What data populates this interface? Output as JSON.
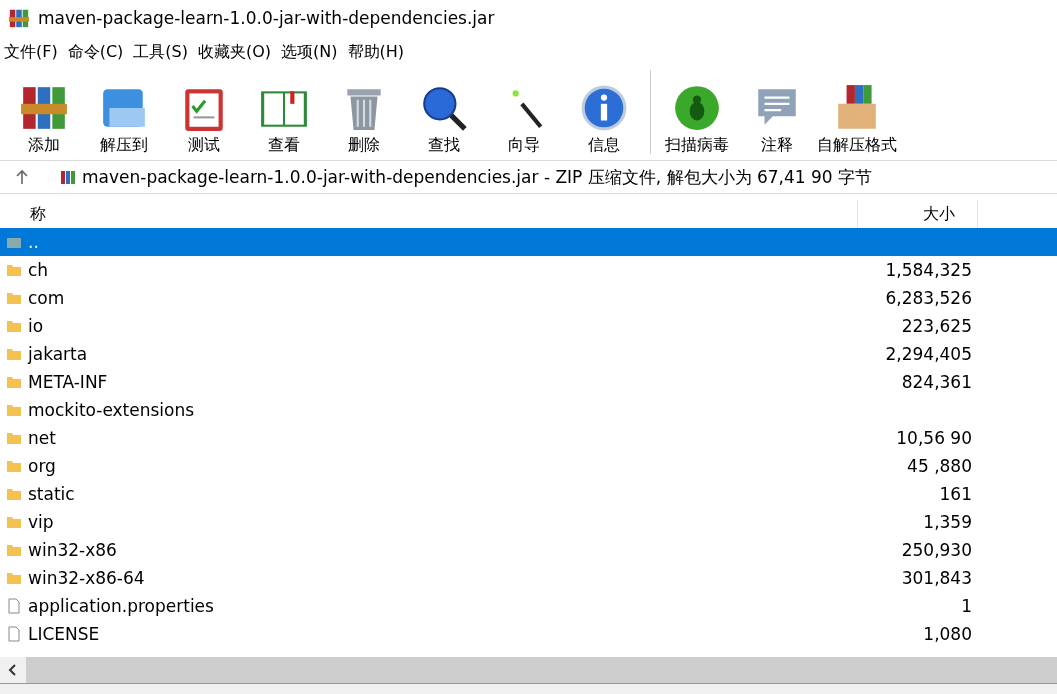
{
  "window": {
    "title": "maven-package-learn-1.0.0-jar-with-dependencies.jar"
  },
  "menu": [
    "文件(F)",
    "命令(C)",
    "工具(S)",
    "收藏夹(O)",
    "选项(N)",
    "帮助(H)"
  ],
  "toolbar": [
    {
      "kind": "add",
      "label": "添加"
    },
    {
      "kind": "extract",
      "label": "解压到"
    },
    {
      "kind": "test",
      "label": "测试"
    },
    {
      "kind": "view",
      "label": "查看"
    },
    {
      "kind": "delete",
      "label": "删除"
    },
    {
      "kind": "find",
      "label": "查找"
    },
    {
      "kind": "wizard",
      "label": "向导"
    },
    {
      "kind": "info",
      "label": "信息"
    },
    {
      "kind": "virus",
      "label": "扫描病毒"
    },
    {
      "kind": "comment",
      "label": "注释"
    },
    {
      "kind": "sfx",
      "label": "自解压格式"
    }
  ],
  "address": {
    "text": "maven-package-learn-1.0.0-jar-with-dependencies.jar - ZIP 压缩文件, 解包大小为 67,41 90 字节"
  },
  "table": {
    "columns": [
      "称",
      "大小"
    ],
    "rows": [
      {
        "kind": "up",
        "name": "..",
        "size": "",
        "selected": true
      },
      {
        "kind": "folder",
        "name": "ch",
        "size": "1,584,325",
        "selected": false
      },
      {
        "kind": "folder",
        "name": "com",
        "size": "6,283,526",
        "selected": false
      },
      {
        "kind": "folder",
        "name": "io",
        "size": "223,625",
        "selected": false
      },
      {
        "kind": "folder",
        "name": "jakarta",
        "size": "2,294,405",
        "selected": false
      },
      {
        "kind": "folder",
        "name": "META-INF",
        "size": "824,361",
        "selected": false
      },
      {
        "kind": "folder",
        "name": "mockito-extensions",
        "size": "",
        "selected": false
      },
      {
        "kind": "folder",
        "name": "net",
        "size": "10,56 90",
        "selected": false
      },
      {
        "kind": "folder",
        "name": "org",
        "size": "45 ,880",
        "selected": false
      },
      {
        "kind": "folder",
        "name": "static",
        "size": "161",
        "selected": false
      },
      {
        "kind": "folder",
        "name": "vip",
        "size": "1,359",
        "selected": false
      },
      {
        "kind": "folder",
        "name": "win32-x86",
        "size": "250,930",
        "selected": false
      },
      {
        "kind": "folder",
        "name": "win32-x86-64",
        "size": "301,843",
        "selected": false
      },
      {
        "kind": "file",
        "name": "application.properties",
        "size": "1",
        "selected": false
      },
      {
        "kind": "file",
        "name": "LICENSE",
        "size": "1,080",
        "selected": false
      }
    ]
  }
}
